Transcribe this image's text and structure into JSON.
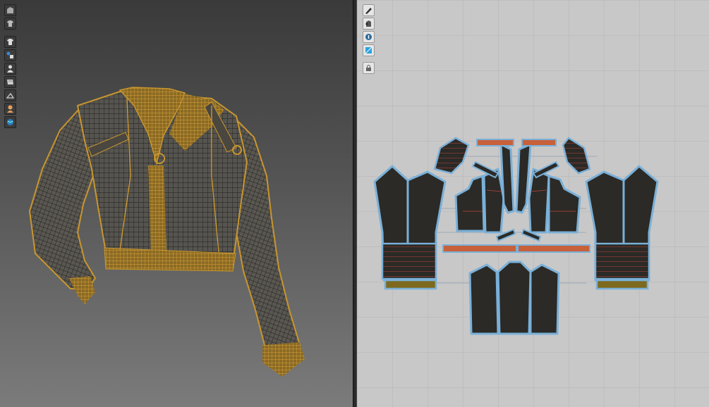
{
  "left_panel": {
    "tools": [
      {
        "icon": "garment-avatar-icon"
      },
      {
        "icon": "shirt-outline-icon"
      },
      {
        "icon": "shirt-icon"
      },
      {
        "icon": "avatar-color-icon"
      },
      {
        "icon": "avatar-icon"
      },
      {
        "icon": "folded-fabric-icon"
      },
      {
        "icon": "hanger-icon"
      },
      {
        "icon": "skin-avatar-icon"
      },
      {
        "icon": "globe-icon"
      }
    ]
  },
  "right_panel": {
    "tools": [
      {
        "icon": "pen-tool-icon"
      },
      {
        "icon": "pattern-add-icon"
      },
      {
        "icon": "info-pin-icon"
      },
      {
        "icon": "texture-square-icon"
      },
      {
        "icon": "pattern-lock-icon"
      }
    ]
  },
  "colors": {
    "background_3d_top": "#3a3a3a",
    "background_2d": "#c8c8c8",
    "grid": "#b4b4b4",
    "mesh_gold": "#c8962e",
    "mesh_dark": "#2a2a2a",
    "pattern_fill": "#2b2a26",
    "pattern_outline": "#7ab0d8",
    "cuff_band": "#7d6a1f",
    "strap_orange": "#c8603a",
    "stitch_red": "#b8443a"
  }
}
